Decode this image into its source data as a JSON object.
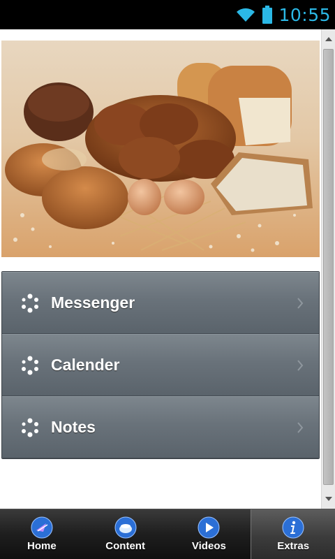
{
  "status_bar": {
    "time": "10:55"
  },
  "menu": {
    "items": [
      {
        "label": "Messenger"
      },
      {
        "label": "Calender"
      },
      {
        "label": "Notes"
      }
    ]
  },
  "bottom_nav": {
    "items": [
      {
        "label": "Home",
        "icon": "home-icon"
      },
      {
        "label": "Content",
        "icon": "content-icon"
      },
      {
        "label": "Videos",
        "icon": "play-icon"
      },
      {
        "label": "Extras",
        "icon": "info-icon"
      }
    ],
    "active_index": 3
  },
  "colors": {
    "accent": "#2bb8e6",
    "menu_bg": "#69727a"
  }
}
